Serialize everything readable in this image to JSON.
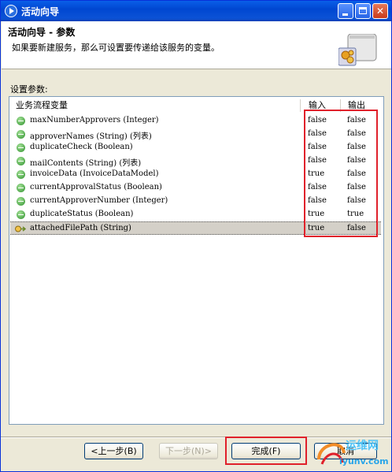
{
  "window": {
    "title": "活动向导"
  },
  "header": {
    "title": "活动向导 - 参数",
    "description": "如果要新建服务，那么可设置要传递给该服务的变量。"
  },
  "params_label": "设置参数:",
  "table": {
    "col_name": "业务流程变量",
    "col_in": "输入",
    "col_out": "输出",
    "rows": [
      {
        "name": "maxNumberApprovers (Integer)",
        "in": "false",
        "out": "false"
      },
      {
        "name": "approverNames (String) (列表)",
        "in": "false",
        "out": "false"
      },
      {
        "name": "duplicateCheck (Boolean)",
        "in": "false",
        "out": "false"
      },
      {
        "name": "mailContents (String) (列表)",
        "in": "false",
        "out": "false"
      },
      {
        "name": "invoiceData (InvoiceDataModel)",
        "in": "true",
        "out": "false"
      },
      {
        "name": "currentApprovalStatus (Boolean)",
        "in": "false",
        "out": "false"
      },
      {
        "name": "currentApproverNumber (Integer)",
        "in": "false",
        "out": "false"
      },
      {
        "name": "duplicateStatus (Boolean)",
        "in": "true",
        "out": "true"
      },
      {
        "name": "attachedFilePath (String)",
        "in": "true",
        "out": "false"
      }
    ]
  },
  "buttons": {
    "back": "<上一步(B)",
    "next": "下一步(N)>",
    "finish": "完成(F)",
    "cancel": "取消"
  },
  "watermark": {
    "line1": "运维网",
    "line2": "iyunv.com"
  },
  "colors": {
    "titlebar": "#0a5fe8",
    "highlight": "#e0212b",
    "window_bg": "#ece9d8"
  }
}
